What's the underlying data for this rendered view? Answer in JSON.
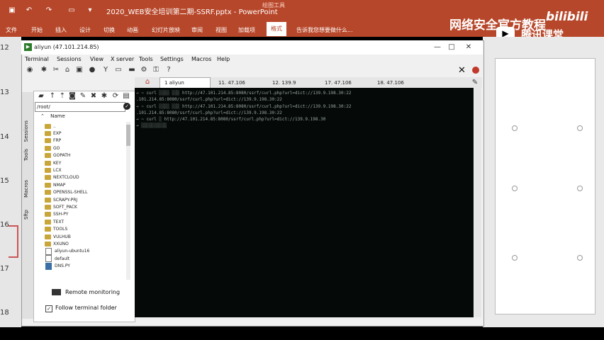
{
  "powerpoint": {
    "doc_title": "2020_WEB安全培训第二期-SSRF.pptx - PowerPoint",
    "contextual_group": "绘图工具",
    "tabs": [
      "文件",
      "开始",
      "插入",
      "设计",
      "切换",
      "动画",
      "幻灯片放映",
      "审阅",
      "视图",
      "加载项",
      "格式"
    ],
    "search_hint": "告诉我您想要做什么...",
    "slide_numbers": [
      "12",
      "13",
      "14",
      "15",
      "16",
      "17",
      "18"
    ]
  },
  "brand": {
    "title": "网络安全官方教程",
    "logo": "bilibili",
    "subtitle": "腾讯课堂",
    "play_icon": "play-icon"
  },
  "xshell": {
    "title": "aliyun (47.101.214.85)",
    "menu": [
      "Terminal",
      "Sessions",
      "View",
      "X server",
      "Tools",
      "Settings",
      "Macros",
      "Help"
    ],
    "tabs": [
      {
        "label": "1 aliyun",
        "active": true
      },
      {
        "label": "11. 47.106",
        "active": false
      },
      {
        "label": "12. 139.9",
        "active": false
      },
      {
        "label": "17. 47.106",
        "active": false
      },
      {
        "label": "18. 47.106",
        "active": false
      }
    ],
    "side_tabs": [
      "Sessions",
      "Tools",
      "Macros",
      "Sftp"
    ],
    "path": "/root/",
    "column_header": "Name",
    "files": [
      {
        "name": "..",
        "type": "folder"
      },
      {
        "name": "EXP",
        "type": "folder"
      },
      {
        "name": "FRP",
        "type": "folder"
      },
      {
        "name": "GO",
        "type": "folder"
      },
      {
        "name": "GOPATH",
        "type": "folder"
      },
      {
        "name": "KEY",
        "type": "folder"
      },
      {
        "name": "LCX",
        "type": "folder"
      },
      {
        "name": "NEXTCLOUD",
        "type": "folder"
      },
      {
        "name": "NMAP",
        "type": "folder"
      },
      {
        "name": "OPENSSL-SHELL",
        "type": "folder"
      },
      {
        "name": "SCRAPY-PRJ",
        "type": "folder"
      },
      {
        "name": "SOFT_PACK",
        "type": "folder"
      },
      {
        "name": "SSH-PY",
        "type": "folder"
      },
      {
        "name": "TEXT",
        "type": "folder"
      },
      {
        "name": "TOOLS",
        "type": "folder"
      },
      {
        "name": "VULHUB",
        "type": "folder"
      },
      {
        "name": "XXUNO",
        "type": "folder"
      },
      {
        "name": "aliyun-ubuntu16",
        "type": "file"
      },
      {
        "name": "default",
        "type": "file"
      },
      {
        "name": "DNS.PY",
        "type": "py"
      }
    ],
    "remote_monitoring": "Remote monitoring",
    "follow_terminal": "Follow terminal folder"
  },
  "terminal": {
    "lines": [
      "→  ~ curl  ░░░░  ░░░ http://47.101.214.85:8080/ssrf/curl.php?url=dict://139.9.198.30:22",
      ".101.214.85:8080/ssrf/curl.php?url=dict://139.9.198.30:22",
      "→  ~ curl  ░░░░  ░░░ http://47.101.214.85:8080/ssrf/curl.php?url=dict://139.9.198.30:22",
      ".101.214.85:8080/ssrf/curl.php?url=dict://139.9.198.30:22",
      "→  ~ curl  ░  http://47.101.214.85:8080/ssrf/curl.php?url=dict://139.9.198.30",
      "→  ░░░░░░░░░░"
    ]
  }
}
